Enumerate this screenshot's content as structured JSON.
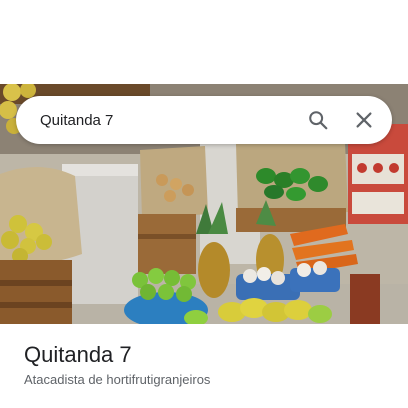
{
  "search": {
    "query": "Quitanda 7",
    "search_icon": "search-icon",
    "clear_icon": "close-icon"
  },
  "place": {
    "title": "Quitanda 7",
    "category": "Atacadista de hortifrutigranjeiros"
  },
  "photo": {
    "subject": "produce-stand-photo"
  },
  "colors": {
    "title_text": "#202124",
    "secondary_text": "#5f6368",
    "icon": "#5f6368"
  }
}
